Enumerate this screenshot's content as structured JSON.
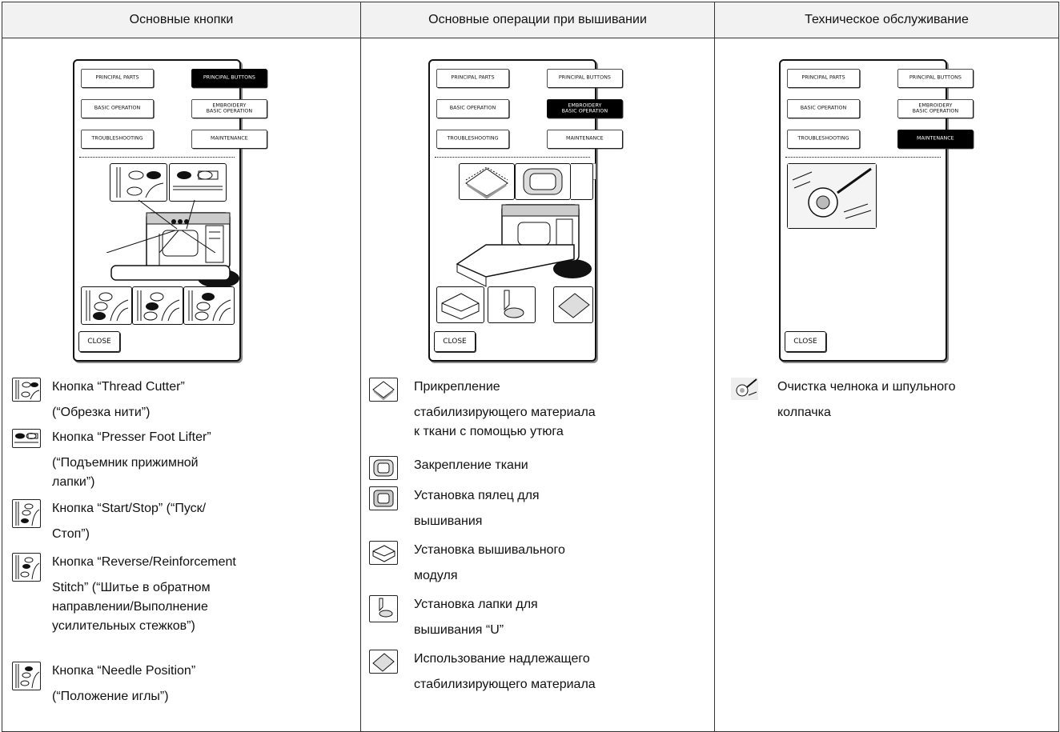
{
  "columns": [
    {
      "header": "Основные кнопки",
      "screen": {
        "buttons": [
          "PRINCIPAL PARTS",
          "PRINCIPAL BUTTONS",
          "BASIC OPERATION",
          "EMBROIDERY BASIC OPERATION",
          "TROUBLESHOOTING",
          "MAINTENANCE"
        ],
        "active": "PRINCIPAL BUTTONS",
        "close": "CLOSE"
      },
      "items": [
        {
          "icon": "thread-cutter-button-icon",
          "lines": [
            "Кнопка “Thread Cutter”",
            "(“Обрезка нити”)"
          ]
        },
        {
          "icon": "presser-foot-lifter-button-icon",
          "lines": [
            "Кнопка “Presser Foot Lifter”",
            "(“Подъемник прижимной",
            "лапки”)"
          ]
        },
        {
          "icon": "start-stop-button-icon",
          "lines": [
            "Кнопка “Start/Stop” (“Пуск/",
            "Стоп”)"
          ]
        },
        {
          "icon": "reverse-stitch-button-icon",
          "lines": [
            "Кнопка “Reverse/Reinforcement",
            "Stitch” (“Шитье в обратном",
            "направлении/Выполнение",
            "усилительных стежков”)"
          ]
        },
        {
          "icon": "needle-position-button-icon",
          "lines": [
            "Кнопка “Needle Position”",
            "(“Положение иглы”)"
          ]
        }
      ]
    },
    {
      "header": "Основные операции при вышивании",
      "screen": {
        "buttons": [
          "PRINCIPAL PARTS",
          "PRINCIPAL BUTTONS",
          "BASIC OPERATION",
          "EMBROIDERY BASIC OPERATION",
          "TROUBLESHOOTING",
          "MAINTENANCE"
        ],
        "active": "EMBROIDERY BASIC OPERATION",
        "close": "CLOSE"
      },
      "items": [
        {
          "icon": "stabilizer-iron-icon",
          "lines": [
            "Прикрепление",
            "стабилизирующего материала",
            "к ткани с помощью утюга"
          ]
        },
        {
          "icon": "hoop-fabric-icon",
          "lines": [
            "Закрепление ткани"
          ]
        },
        {
          "icon": "attach-hoop-icon",
          "lines": [
            "Установка пялец для",
            "вышивания"
          ]
        },
        {
          "icon": "embroidery-unit-icon",
          "lines": [
            "Установка вышивального",
            "модуля"
          ]
        },
        {
          "icon": "embroidery-foot-icon",
          "lines": [
            "Установка лапки для",
            "вышивания “U”"
          ]
        },
        {
          "icon": "stabilizer-use-icon",
          "lines": [
            "Использование надлежащего",
            "стабилизирующего материала"
          ]
        }
      ]
    },
    {
      "header": "Техническое обслуживание",
      "screen": {
        "buttons": [
          "PRINCIPAL PARTS",
          "PRINCIPAL BUTTONS",
          "BASIC OPERATION",
          "EMBROIDERY BASIC OPERATION",
          "TROUBLESHOOTING",
          "MAINTENANCE"
        ],
        "active": "MAINTENANCE",
        "close": "CLOSE"
      },
      "items": [
        {
          "icon": "shuttle-cleaning-icon",
          "lines": [
            "Очистка челнока и шпульного",
            "колпачка"
          ]
        }
      ]
    }
  ]
}
